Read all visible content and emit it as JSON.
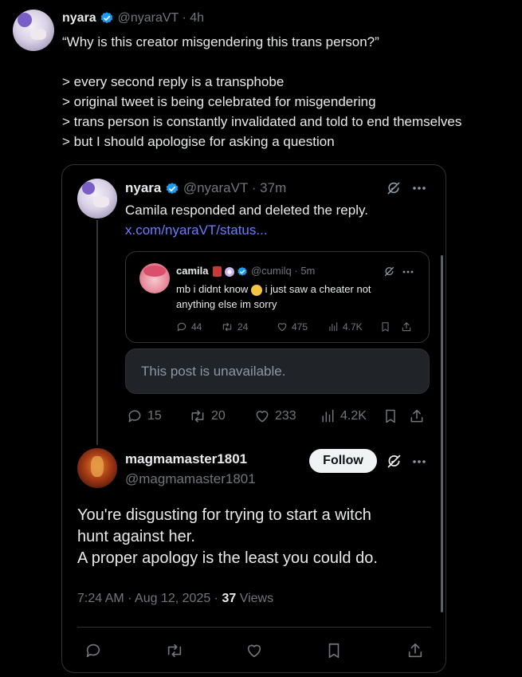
{
  "outer": {
    "name": "nyara",
    "handle": "@nyaraVT",
    "time": "4h",
    "quote_line": "“Why is this creator misgendering this trans person?”",
    "greentext": [
      "> every second reply is a transphobe",
      "> original tweet is being celebrated for misgendering",
      "> trans person is constantly invalidated and told to end themselves",
      "> but I should apologise for asking a question"
    ]
  },
  "card": {
    "name": "nyara",
    "handle": "@nyaraVT",
    "time": "37m",
    "text": "Camila responded and deleted the reply.",
    "link": "x.com/nyaraVT/status...",
    "nested": {
      "name": "camila",
      "handle": "@cumilq",
      "time": "5m",
      "text_before": "mb i didnt know",
      "text_after": "i just saw a cheater not",
      "text_line2": "anything else im sorry",
      "stats": {
        "replies": "44",
        "reposts": "24",
        "likes": "475",
        "views": "4.7K"
      }
    },
    "unavailable": "This post is unavailable.",
    "stats": {
      "replies": "15",
      "reposts": "20",
      "likes": "233",
      "views": "4.2K"
    },
    "reply": {
      "name": "magmamaster1801",
      "handle": "@magmamaster1801",
      "follow_label": "Follow",
      "body": [
        "You're disgusting for trying to start a witch",
        "hunt against her.",
        "A proper apology is the least you could do."
      ],
      "timestamp": "7:24 AM · Aug 12, 2025 · ",
      "views_count": "37",
      "views_label": " Views"
    }
  },
  "colors": {
    "accent": "#1d9bf0",
    "link": "#6b7cff",
    "border": "#2f3336",
    "muted": "#71767b"
  }
}
